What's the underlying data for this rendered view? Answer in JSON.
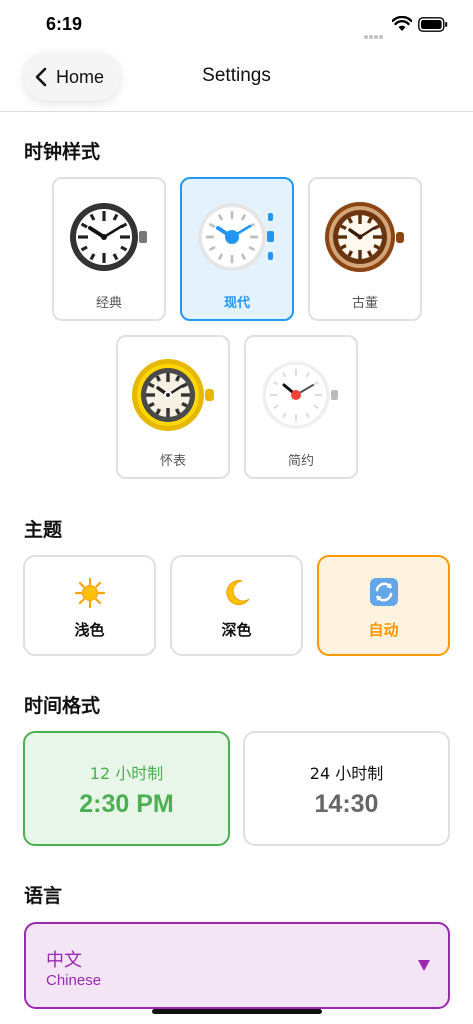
{
  "status_bar": {
    "time": "6:19"
  },
  "nav": {
    "back_label": "Home",
    "title": "Settings"
  },
  "clock_style": {
    "title": "时钟样式",
    "options": [
      {
        "label": "经典",
        "selected": false
      },
      {
        "label": "现代",
        "selected": true
      },
      {
        "label": "古董",
        "selected": false
      },
      {
        "label": "怀表",
        "selected": false
      },
      {
        "label": "简约",
        "selected": false
      }
    ]
  },
  "theme": {
    "title": "主题",
    "options": [
      {
        "label": "浅色",
        "icon": "sun-icon",
        "selected": false
      },
      {
        "label": "深色",
        "icon": "moon-icon",
        "selected": false
      },
      {
        "label": "自动",
        "icon": "cycle-icon",
        "selected": true
      }
    ]
  },
  "time_format": {
    "title": "时间格式",
    "options": [
      {
        "label": "12 小时制",
        "example": "2:30 PM",
        "selected": true
      },
      {
        "label": "24 小时制",
        "example": "14:30",
        "selected": false
      }
    ]
  },
  "language": {
    "title": "语言",
    "current": "中文",
    "current_sub": "Chinese"
  },
  "colors": {
    "clock_selected": "#2196f3",
    "theme_selected": "#ff9800",
    "time_selected": "#4caf50",
    "language_accent": "#9c27b0"
  }
}
